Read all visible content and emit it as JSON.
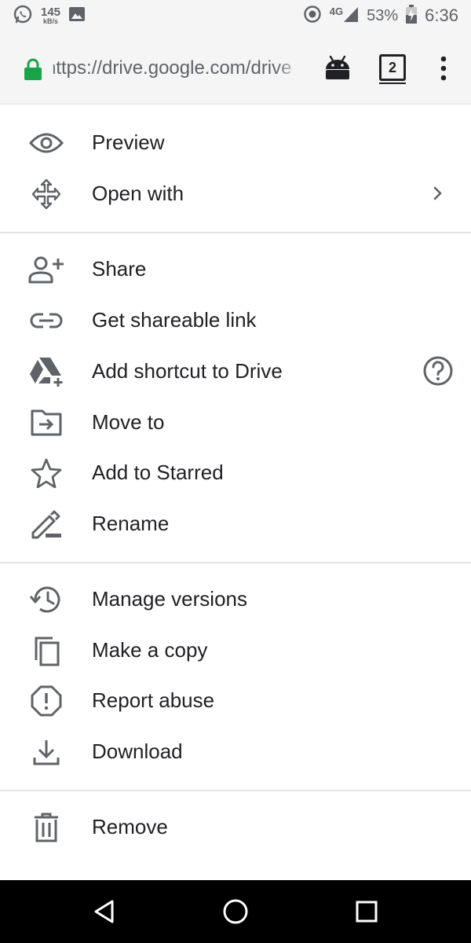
{
  "status_bar": {
    "net_speed_value": "145",
    "net_speed_unit": "kB/s",
    "network_type": "4G",
    "battery": "53%",
    "time": "6:36",
    "icons": [
      "whatsapp-icon",
      "image-icon",
      "data-saver-icon",
      "signal-icon",
      "battery-charging-icon"
    ]
  },
  "browser": {
    "url": "https://drive.google.com/drive",
    "tab_count": "2",
    "icons": [
      "lock-icon",
      "android-icon",
      "overflow-menu-icon"
    ],
    "colors": {
      "lock": "#1aa34a"
    }
  },
  "menu": {
    "sections": [
      {
        "items": [
          {
            "label": "Preview",
            "icon": "eye-icon"
          },
          {
            "label": "Open with",
            "icon": "move-arrows-icon",
            "trailing": "chevron-right-icon"
          }
        ]
      },
      {
        "items": [
          {
            "label": "Share",
            "icon": "person-add-icon"
          },
          {
            "label": "Get shareable link",
            "icon": "link-icon"
          },
          {
            "label": "Add shortcut to Drive",
            "icon": "drive-add-icon",
            "trailing": "help-circle-icon"
          },
          {
            "label": "Move to",
            "icon": "folder-move-icon"
          },
          {
            "label": "Add to Starred",
            "icon": "star-outline-icon"
          },
          {
            "label": "Rename",
            "icon": "pencil-icon"
          }
        ]
      },
      {
        "items": [
          {
            "label": "Manage versions",
            "icon": "history-icon"
          },
          {
            "label": "Make a copy",
            "icon": "copy-icon"
          },
          {
            "label": "Report abuse",
            "icon": "report-icon"
          },
          {
            "label": "Download",
            "icon": "download-icon"
          }
        ]
      },
      {
        "items": [
          {
            "label": "Remove",
            "icon": "trash-icon"
          }
        ]
      }
    ]
  },
  "nav_bar": {
    "icons": [
      "back-icon",
      "home-icon",
      "recents-icon"
    ]
  }
}
